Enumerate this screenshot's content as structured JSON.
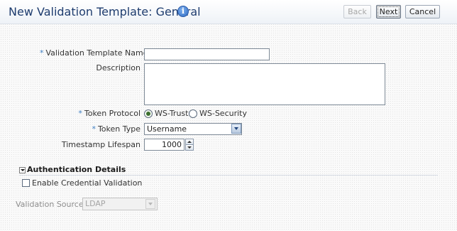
{
  "header": {
    "title": "New Validation Template: General",
    "back_label": "Back",
    "next_label": "Next",
    "cancel_label": "Cancel"
  },
  "form": {
    "template_name": {
      "label": "Validation Template Name",
      "required": true,
      "value": ""
    },
    "description": {
      "label": "Description",
      "value": ""
    },
    "token_protocol": {
      "label": "Token Protocol",
      "required": true,
      "options": [
        "WS-Trust",
        "WS-Security"
      ],
      "selected": "WS-Trust"
    },
    "token_type": {
      "label": "Token Type",
      "required": true,
      "value": "Username"
    },
    "timestamp_lifespan": {
      "label": "Timestamp Lifespan",
      "value": "1000"
    }
  },
  "auth_section": {
    "title": "Authentication Details",
    "expanded": true,
    "credential_validation_label": "Enable Credential Validation",
    "credential_validation_checked": false,
    "validation_source": {
      "label": "Validation Source",
      "value": "LDAP",
      "disabled": true
    }
  },
  "colors": {
    "title": "#1e3c6e",
    "required_asterisk": "#3f7fc2",
    "radio_selected": "#3c6f2f"
  }
}
